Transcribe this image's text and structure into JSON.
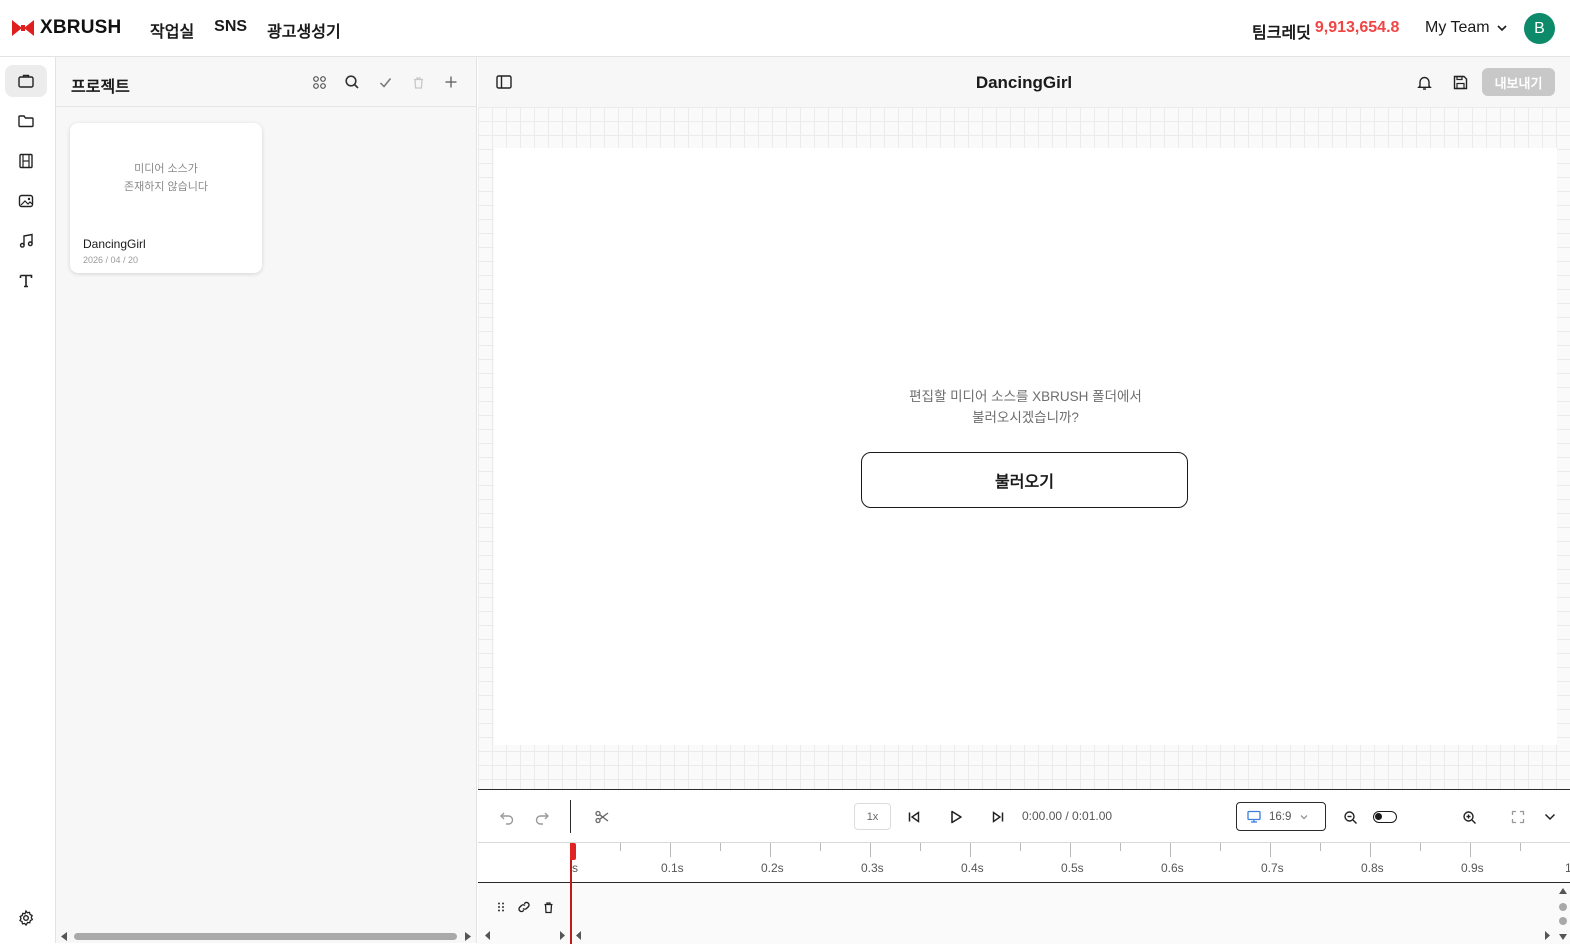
{
  "header": {
    "logo_text": "XBRUSH",
    "nav": [
      "작업실",
      "SNS",
      "광고생성기"
    ],
    "credits_label": "팀크레딧",
    "credits_value": "9,913,654.8",
    "team_name": "My Team",
    "avatar_initial": "B"
  },
  "rail": {
    "items": [
      "briefcase-icon",
      "folder-icon",
      "film-icon",
      "image-icon",
      "music-icon",
      "text-icon"
    ],
    "bottom": "settings-icon"
  },
  "panel": {
    "title": "프로젝트",
    "tools": [
      "grid-view-icon",
      "search-icon",
      "check-icon",
      "trash-icon",
      "plus-icon"
    ],
    "project": {
      "empty_text": "미디어 소스가\n존재하지 않습니다",
      "name": "DancingGirl",
      "date": "2026 / 04 / 20"
    }
  },
  "editor": {
    "title": "DancingGirl",
    "export_label": "내보내기",
    "prompt": "편집할 미디어 소스를 XBRUSH 폴더에서\n불러오시겠습니까?",
    "load_label": "불러오기"
  },
  "timeline": {
    "speed": "1x",
    "timecode": "0:00.00 / 0:01.00",
    "aspect_ratio": "16:9",
    "ruler_labels": [
      "s",
      "0.1s",
      "0.2s",
      "0.3s",
      "0.4s",
      "0.5s",
      "0.6s",
      "0.7s",
      "0.8s",
      "0.9s",
      "1"
    ]
  },
  "colors": {
    "accent_red": "#f04545",
    "avatar_green": "#0d8a6a",
    "playhead": "#e02424"
  }
}
